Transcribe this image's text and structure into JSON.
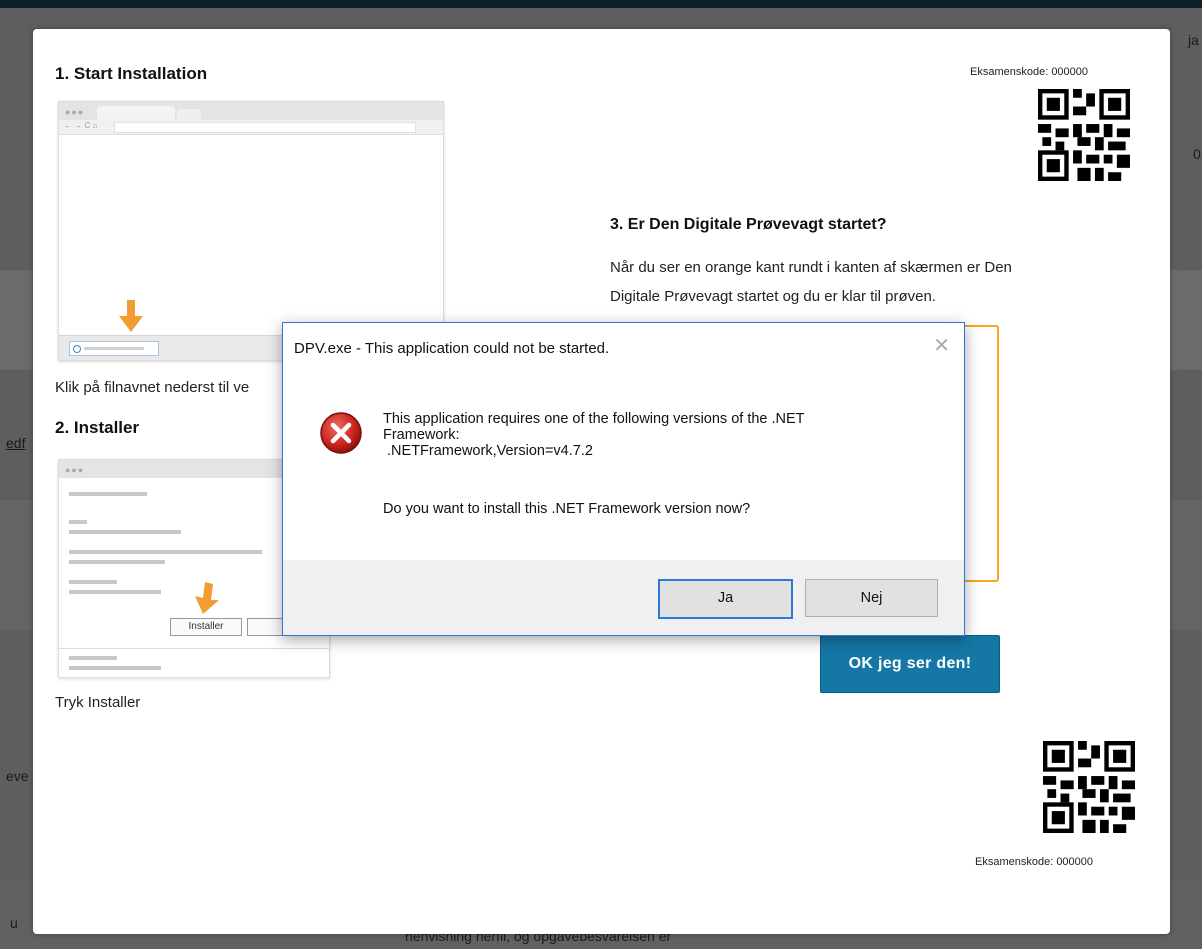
{
  "background": {
    "fragments": [
      "ja",
      "0",
      "edf",
      "eve",
      "u",
      "henvisning herfil, og opgavebesvarelsen er"
    ]
  },
  "modal": {
    "step1": {
      "title": "1. Start Installation",
      "caption": "Klik på filnavnet nederst til ve"
    },
    "step2": {
      "title": "2. Installer",
      "caption": "Tryk Installer",
      "install_button_label": "Installer"
    },
    "step3": {
      "title": "3. Er Den Digitale Prøvevagt startet?",
      "text_line1": "Når du ser en orange kant rundt i kanten af skærmen er Den",
      "text_line2": "Digitale Prøvevagt startet og du er klar til prøven."
    },
    "exam_code_top": "Eksamenskode: 000000",
    "exam_code_bottom": "Eksamenskode: 000000",
    "ok_button": "OK jeg ser den!",
    "accent_color": "#f5a623",
    "button_color": "#1577a5"
  },
  "dialog": {
    "title": "DPV.exe - This application could not be started.",
    "icon": "error-icon",
    "message_line1": "This application requires one of the following versions of the .NET",
    "message_line2": "Framework:",
    "message_line3": " .NETFramework,Version=v4.7.2",
    "question": "Do you want to install this .NET Framework version now?",
    "yes_button": "Ja",
    "no_button": "Nej"
  }
}
